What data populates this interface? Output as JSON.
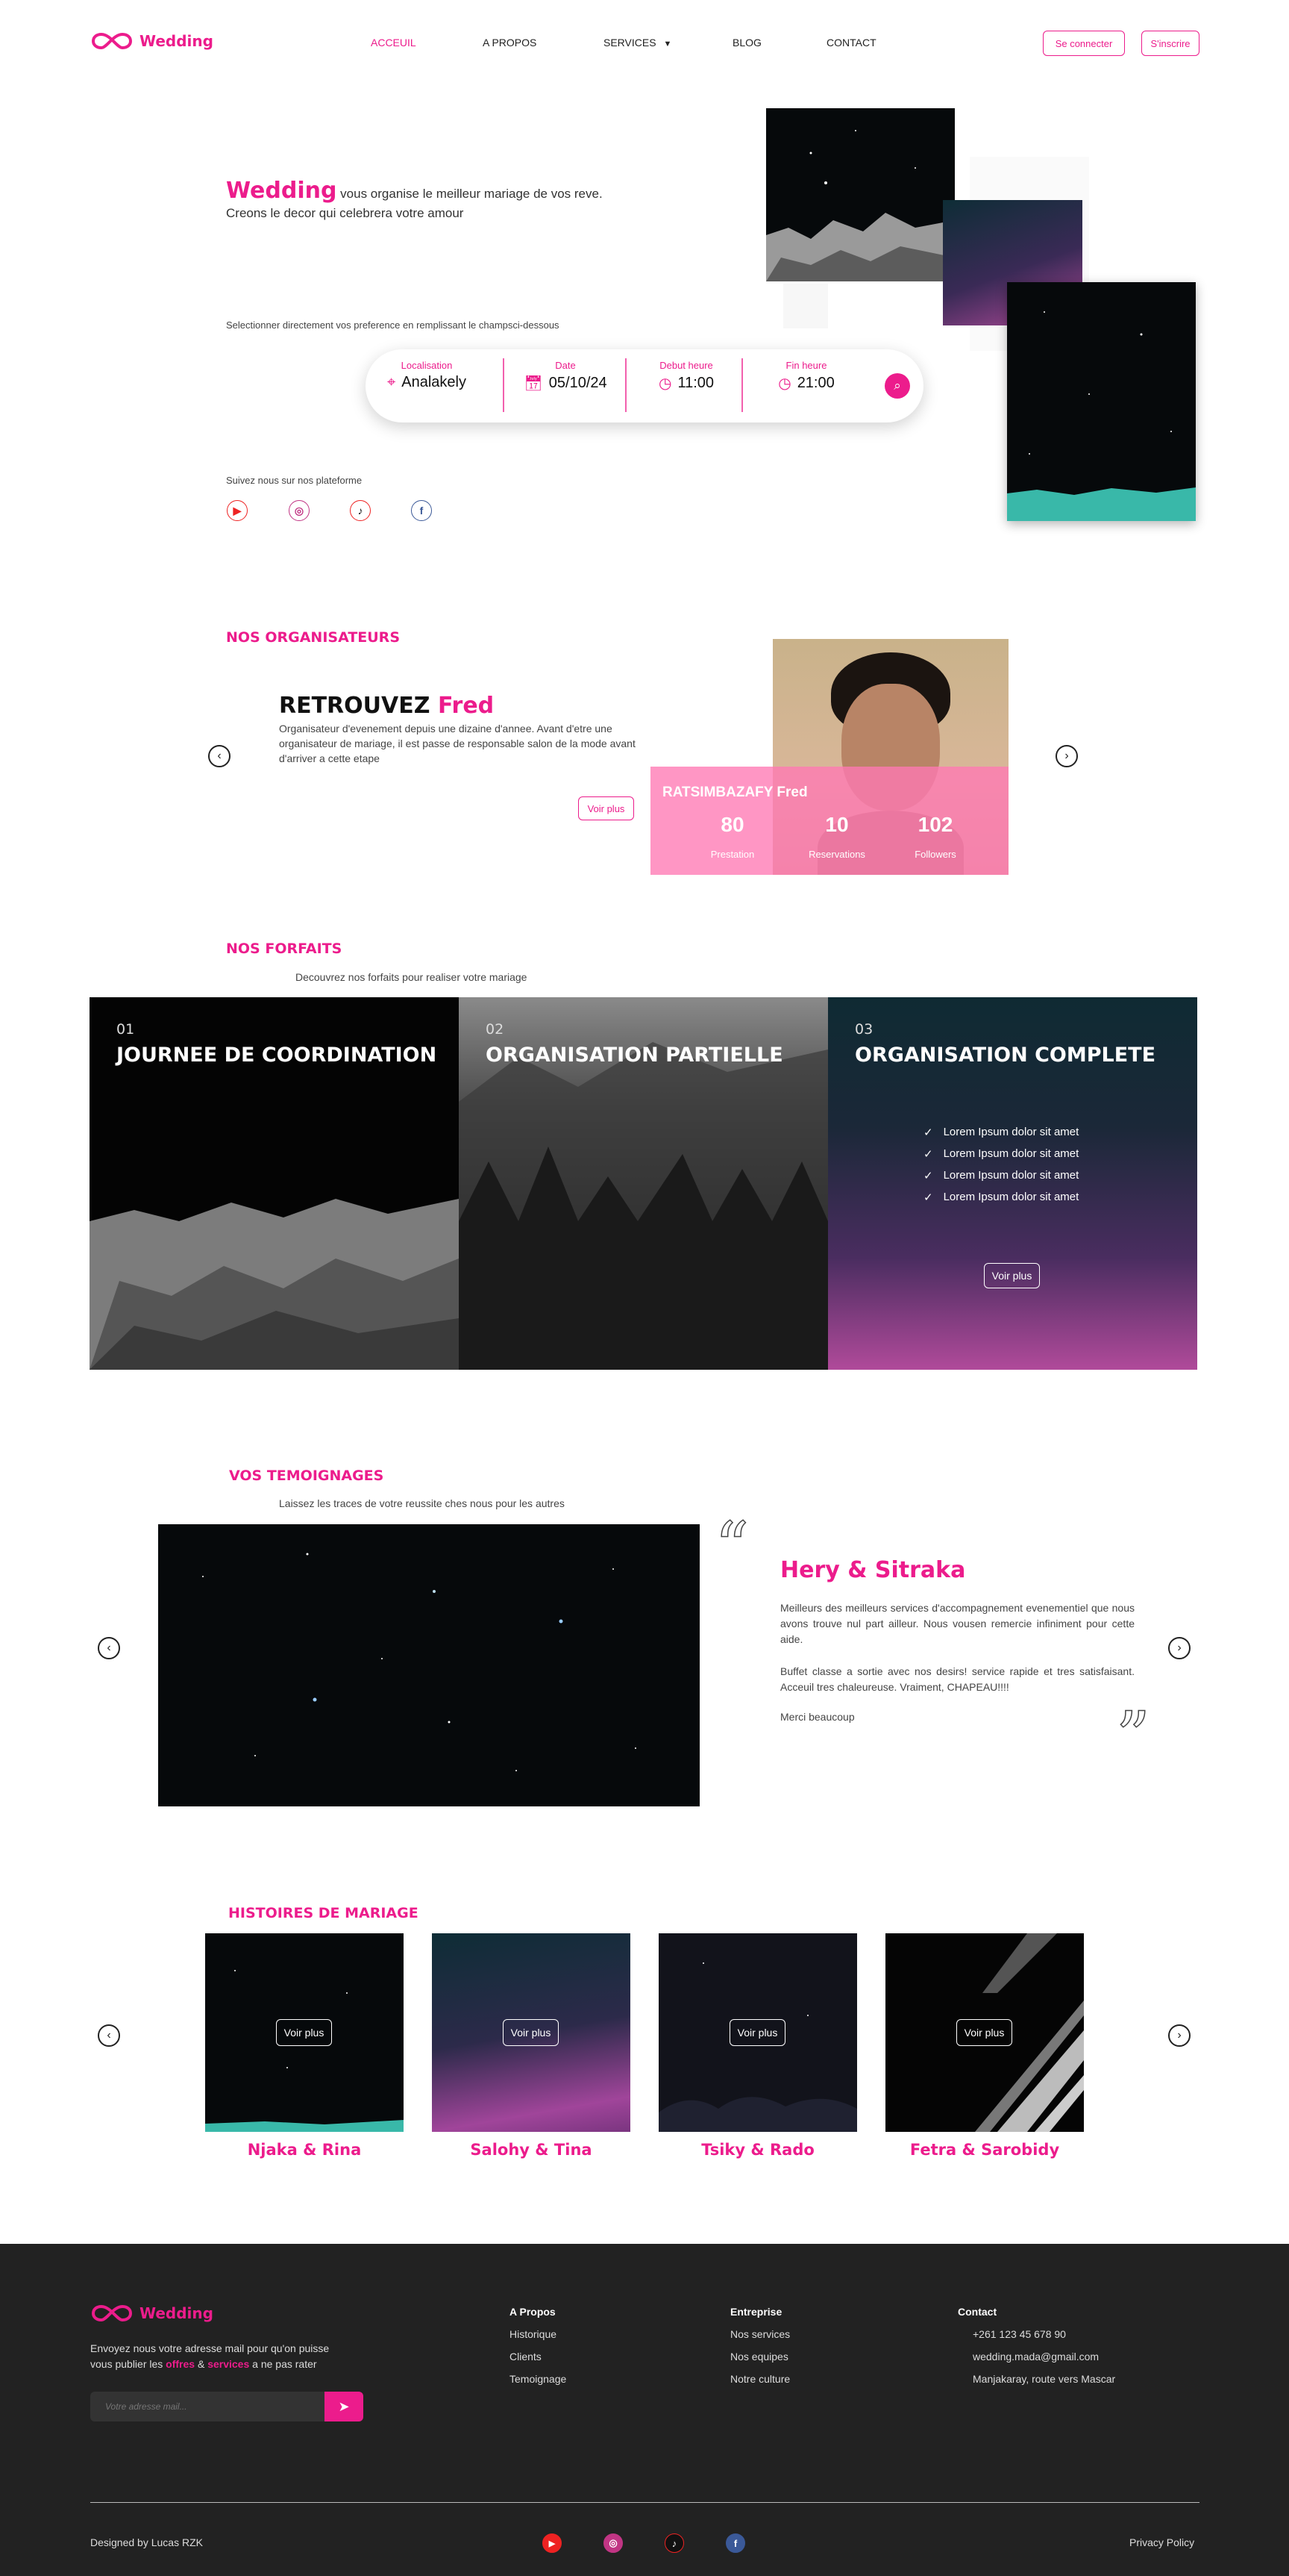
{
  "header": {
    "brand": "Wedding",
    "nav": [
      {
        "label": "ACCEUIL",
        "active": true
      },
      {
        "label": "A PROPOS"
      },
      {
        "label": "SERVICES"
      },
      {
        "label": "BLOG"
      },
      {
        "label": "CONTACT"
      }
    ],
    "login": "Se connecter",
    "signup": "S'inscrire"
  },
  "hero": {
    "brand": "Wedding",
    "tagline": "vous organise le meilleur mariage de vos reve.",
    "tagline2": "Creons le decor qui celebrera votre amour",
    "instruction": "Selectionner directement vos preference en remplissant le champsci-dessous",
    "search": {
      "loc_label": "Localisation",
      "loc_value": "Analakely",
      "date_label": "Date",
      "date_value": "05/10/24",
      "start_label": "Debut heure",
      "start_value": "11:00",
      "end_label": "Fin heure",
      "end_value": "21:00"
    },
    "follow": "Suivez nous sur nos plateforme"
  },
  "organisers": {
    "title": "NOS ORGANISATEURS",
    "heading": "RETROUVEZ",
    "name": "Fred",
    "desc": "Organisateur d'evenement depuis une dizaine d'annee. Avant d'etre une organisateur de mariage, il est passe de responsable salon de la mode avant d'arriver a cette etape",
    "more": "Voir plus",
    "card_name": "RATSIMBAZAFY Fred",
    "stats": [
      {
        "value": "80",
        "label": "Prestation"
      },
      {
        "value": "10",
        "label": "Reservations"
      },
      {
        "value": "102",
        "label": "Followers"
      }
    ]
  },
  "forfaits": {
    "title": "NOS FORFAITS",
    "subtitle": "Decouvrez nos forfaits pour realiser votre mariage",
    "packages": [
      {
        "num": "01",
        "name": "JOURNEE DE COORDINATION"
      },
      {
        "num": "02",
        "name": "ORGANISATION PARTIELLE"
      },
      {
        "num": "03",
        "name": "ORGANISATION COMPLETE"
      }
    ],
    "features": [
      "Lorem Ipsum dolor sit amet",
      "Lorem Ipsum dolor sit amet",
      "Lorem Ipsum dolor sit amet",
      "Lorem Ipsum dolor sit amet"
    ],
    "more": "Voir plus"
  },
  "testimonials": {
    "title": "VOS TEMOIGNAGES",
    "subtitle": "Laissez les traces de votre reussite ches nous pour les autres",
    "name": "Hery & Sitraka",
    "p1": "Meilleurs des meilleurs services d'accompagnement evenementiel que nous avons trouve nul part ailleur. Nous vousen remercie infiniment pour cette aide.",
    "p2": "Buffet classe a sortie avec nos desirs! service rapide et tres satisfaisant. Acceuil tres chaleureuse. Vraiment, CHAPEAU!!!!",
    "p3": "Merci beaucoup"
  },
  "stories": {
    "title": "HISTOIRES DE MARIAGE",
    "more": "Voir plus",
    "items": [
      "Njaka & Rina",
      "Salohy & Tina",
      "Tsiky & Rado",
      "Fetra & Sarobidy"
    ]
  },
  "footer": {
    "brand": "Wedding",
    "text1": "Envoyez nous votre adresse mail pour qu'on puisse",
    "text2a": "vous publier les ",
    "offres": "offres",
    "amp": " & ",
    "services": "services",
    "text2b": " a ne pas rater",
    "email_placeholder": "Votre adresse mail...",
    "col1": {
      "title": "A Propos",
      "items": [
        "Historique",
        "Clients",
        "Temoignage"
      ]
    },
    "col2": {
      "title": "Entreprise",
      "items": [
        "Nos services",
        "Nos equipes",
        "Notre culture"
      ]
    },
    "col3": {
      "title": "Contact",
      "items": [
        "+261 123 45 678 90",
        "wedding.mada@gmail.com",
        "Manjakaray, route vers Mascar"
      ]
    },
    "credit": "Designed by Lucas RZK",
    "privacy": "Privacy Policy"
  }
}
